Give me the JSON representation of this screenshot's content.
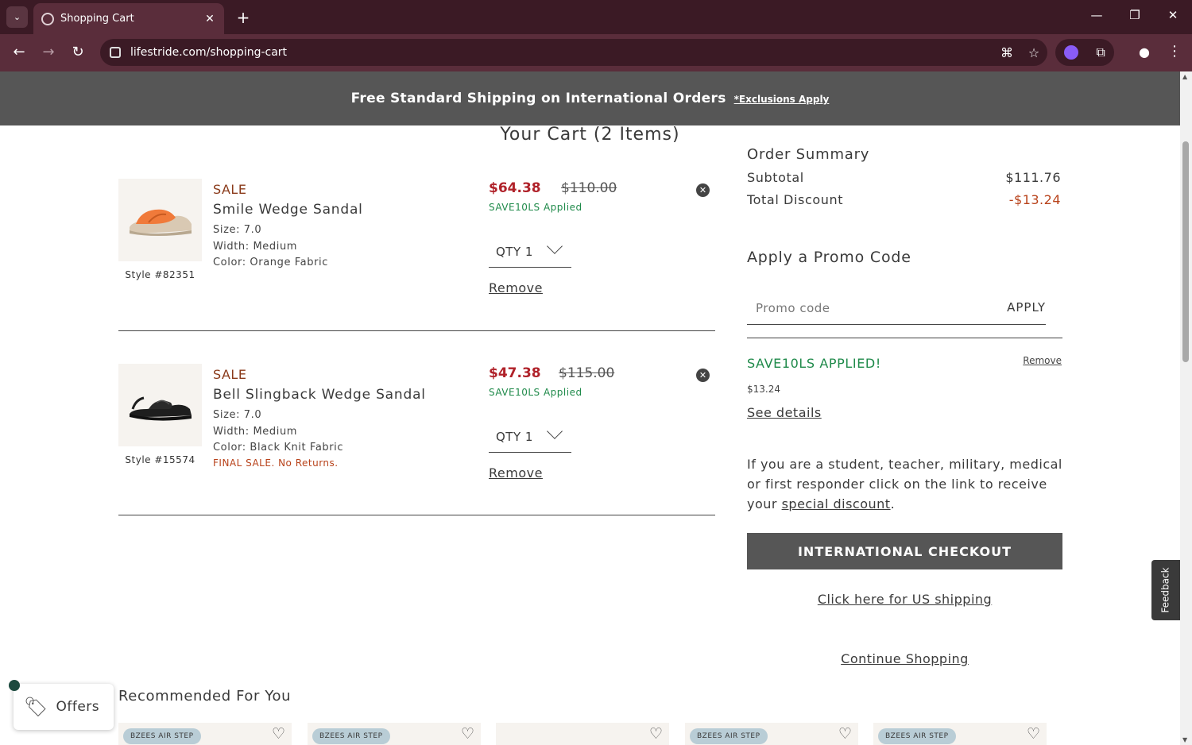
{
  "browser": {
    "tab_title": "Shopping Cart",
    "url": "lifestride.com/shopping-cart"
  },
  "banner": {
    "text": "Free Standard Shipping on International Orders",
    "link": "*Exclusions Apply"
  },
  "cart": {
    "title": "Your Cart (2 Items)",
    "items": [
      {
        "tag": "SALE",
        "name": "Smile Wedge Sandal",
        "size": "Size: 7.0",
        "width": "Width: Medium",
        "color": "Color: Orange Fabric",
        "style": "Style #82351",
        "sale_price": "$64.38",
        "orig_price": "$110.00",
        "promo": "SAVE10LS Applied",
        "qty": "QTY 1",
        "remove": "Remove",
        "shoe_color": "#f07a3a"
      },
      {
        "tag": "SALE",
        "name": "Bell Slingback Wedge Sandal",
        "size": "Size: 7.0",
        "width": "Width: Medium",
        "color": "Color: Black Knit Fabric",
        "final": "FINAL SALE. No Returns.",
        "style": "Style #15574",
        "sale_price": "$47.38",
        "orig_price": "$115.00",
        "promo": "SAVE10LS Applied",
        "qty": "QTY 1",
        "remove": "Remove",
        "shoe_color": "#1e1e1e"
      }
    ]
  },
  "summary": {
    "title": "Order Summary",
    "subtotal_label": "Subtotal",
    "subtotal": "$111.76",
    "discount_label": "Total Discount",
    "discount": "-$13.24",
    "promo_heading": "Apply a Promo Code",
    "promo_placeholder": "Promo code",
    "apply_label": "APPLY",
    "applied_code": "SAVE10LS APPLIED!",
    "applied_remove": "Remove",
    "applied_amount": "$13.24",
    "see_details": "See details",
    "special_text_pre": "If you are a student, teacher, military, medical or first responder click on the link to receive your",
    "special_link": "special discount",
    "special_text_post": ".",
    "checkout": "INTERNATIONAL CHECKOUT",
    "us_shipping": "Click here for US shipping",
    "continue": "Continue Shopping"
  },
  "feedback": "Feedback",
  "recommended": {
    "title": "Recommended For You",
    "badges": [
      "BZEES AIR STEP",
      "BZEES AIR STEP",
      "",
      "BZEES AIR STEP",
      "BZEES AIR STEP"
    ]
  },
  "offers": {
    "label": "Offers"
  },
  "colors": {
    "sale_red": "#b0222a",
    "promo_green": "#1f8a4a",
    "banner_gray": "#565656",
    "browser_frame": "#5a2d3b"
  }
}
